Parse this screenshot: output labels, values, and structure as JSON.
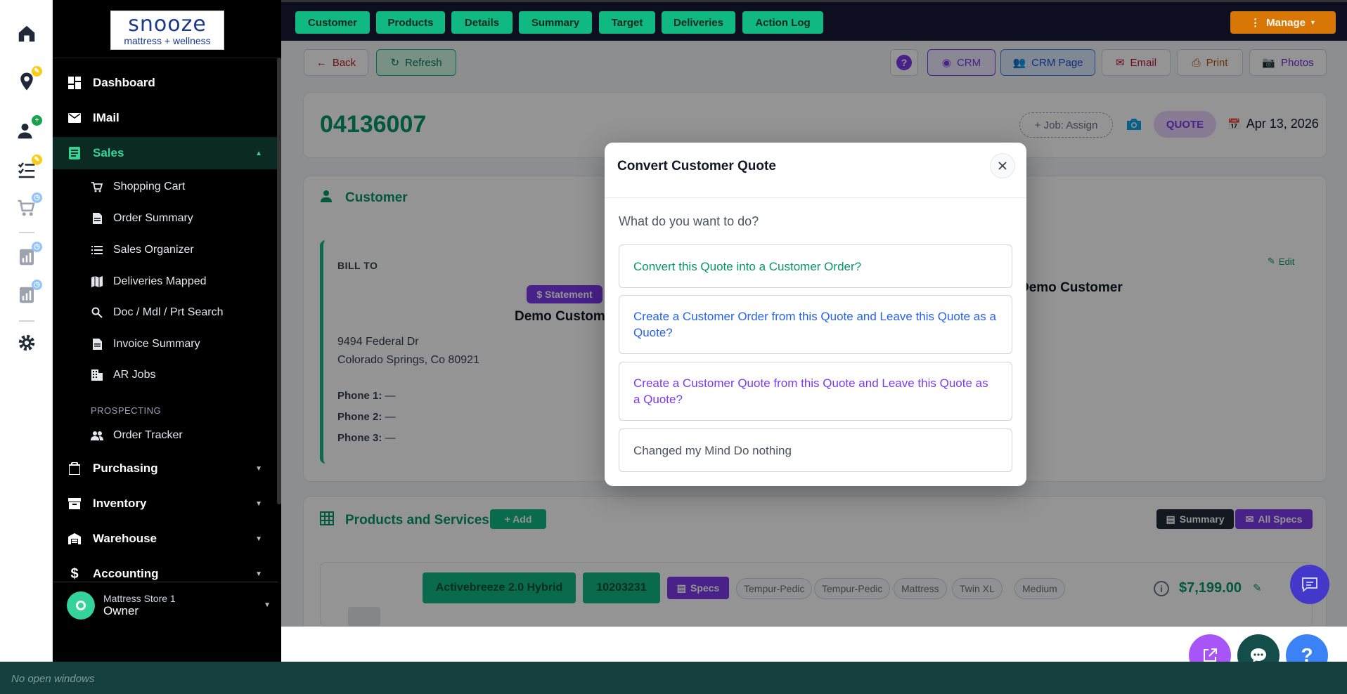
{
  "topbar": {
    "tabs": [
      "Customer",
      "Products",
      "Details",
      "Summary",
      "Target",
      "Deliveries",
      "Action Log"
    ],
    "manage_label": "Manage"
  },
  "sidebar": {
    "logo_name": "snooze",
    "logo_tagline": "mattress + wellness",
    "items": [
      {
        "label": "Dashboard",
        "icon": "dashboard-icon"
      },
      {
        "label": "IMail",
        "icon": "mail-icon"
      },
      {
        "label": "Sales",
        "icon": "sales-icon"
      }
    ],
    "sales_sub": [
      {
        "label": "Shopping Cart",
        "icon": "cart-icon"
      },
      {
        "label": "Order Summary",
        "icon": "document-icon"
      },
      {
        "label": "Sales Organizer",
        "icon": "list-icon"
      },
      {
        "label": "Deliveries Mapped",
        "icon": "map-icon"
      },
      {
        "label": "Doc / Mdl / Prt Search",
        "icon": "search-icon"
      },
      {
        "label": "Invoice Summary",
        "icon": "document-icon"
      },
      {
        "label": "AR Jobs",
        "icon": "building-icon"
      }
    ],
    "prospecting_label": "PROSPECTING",
    "order_tracker": "Order Tracker",
    "groups": [
      "Purchasing",
      "Inventory",
      "Warehouse",
      "Accounting"
    ],
    "profile": {
      "store": "Mattress Store 1",
      "role": "Owner"
    }
  },
  "toolbar": {
    "back": "Back",
    "refresh": "Refresh",
    "crm": "CRM",
    "crm_page": "CRM Page",
    "email": "Email",
    "print": "Print",
    "photos": "Photos"
  },
  "order": {
    "number": "04136007",
    "job_assign": "+ Job: Assign",
    "status": "QUOTE",
    "date": "Apr 13, 2026"
  },
  "customer_section": {
    "title": "Customer",
    "bill_to": "BILL TO",
    "statement": "$ Statement",
    "name": "Demo Customer",
    "address1": "9494 Federal Dr",
    "address2": "Colorado Springs, Co 80921",
    "phone1_label": "Phone 1:",
    "phone2_label": "Phone 2:",
    "phone3_label": "Phone 3:",
    "phone_value": "—",
    "ship_name": "Demo Customer",
    "edit": "Edit"
  },
  "products_section": {
    "title": "Products and Services",
    "add": "+ Add",
    "summary": "Summary",
    "all_specs": "All Specs",
    "product_name": "Activebreeze 2.0 Hybrid",
    "sku": "10203231",
    "specs": "Specs",
    "tags": [
      "Tempur-Pedic",
      "Tempur-Pedic",
      "Mattress",
      "Twin XL",
      "Medium"
    ],
    "price": "$7,199.00"
  },
  "modal": {
    "title": "Convert Customer Quote",
    "question": "What do you want to do?",
    "options": [
      "Convert this Quote into a Customer Order?",
      "Create a Customer Order from this Quote and Leave this Quote as a Quote?",
      "Create a Customer Quote from this Quote and Leave this Quote as a Quote?",
      "Changed my Mind Do nothing"
    ]
  },
  "taskbar": {
    "text": "No open windows"
  },
  "colors": {
    "accent": "#10b981",
    "purple": "#7c3aed",
    "manage": "#d97706",
    "sidebar": "#000000"
  }
}
